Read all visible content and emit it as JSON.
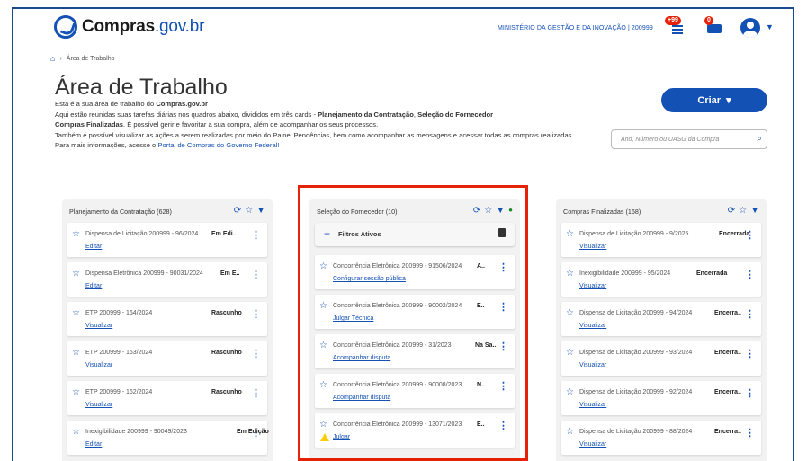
{
  "header": {
    "logo_text_bold": "Compras",
    "logo_text_domain": ".gov.br",
    "ministry": "MINISTÉRIO DA GESTÃO E DA INOVAÇÃO | 200999",
    "notif_badge": "+99",
    "msg_badge": "0"
  },
  "breadcrumb": {
    "current": "Área de Trabalho"
  },
  "page": {
    "title": "Área de Trabalho",
    "intro_l1": "Esta é a sua área de trabalho do ",
    "intro_l1_bold": "Compras.gov.br",
    "intro_l2a": "Aqui estão reunidas suas tarefas diárias nos quadros abaixo, divididos em três cards - ",
    "intro_l2b": "Planejamento da Contratação",
    "intro_l2c": ", ",
    "intro_l2d": "Seleção do Fornecedor",
    "intro_l2e": " e ",
    "intro_l2f": "Compras Finalizadas",
    "intro_l2g": ". É possível gerir e favoritar a sua compra, além de acompanhar os seus processos.",
    "intro_l3": "Também é possível visualizar as ações a serem realizadas por meio do Painel Pendências, bem como acompanhar as mensagens e acessar todas as compras realizadas.",
    "intro_l4a": "Para mais informações, acesse o ",
    "intro_l4b": "Portal de Compras do Governo Federal!",
    "criar_label": "Criar",
    "search_placeholder": "Ano, Número ou UASG da Compra"
  },
  "columns": [
    {
      "title": "Planejamento da Contratação (628)",
      "cards": [
        {
          "text": "Dispensa de Licitação 200999 - 96/2024",
          "status": "Em Edi..",
          "action": "Editar"
        },
        {
          "text": "Dispensa Eletrônica 200999 - 90031/2024",
          "status": "Em E..",
          "action": "Editar"
        },
        {
          "text": "ETP 200999 - 164/2024",
          "status": "Rascunho",
          "action": "Visualizar"
        },
        {
          "text": "ETP 200999 - 163/2024",
          "status": "Rascunho",
          "action": "Visualizar"
        },
        {
          "text": "ETP 200999 - 162/2024",
          "status": "Rascunho",
          "action": "Visualizar"
        },
        {
          "text": "Inexigibilidade 200999 - 90049/2023",
          "status": "Em Edição",
          "action": "Editar"
        }
      ]
    },
    {
      "title": "Seleção do Fornecedor (10)",
      "filter_label": "Filtros Ativos",
      "cards": [
        {
          "text": "Concorrência Eletrônica 200999 - 91506/2024",
          "status": "A..",
          "action": "Configurar sessão pública"
        },
        {
          "text": "Concorrência Eletrônica 200999 - 90002/2024",
          "status": "E..",
          "action": "Julgar Técnica"
        },
        {
          "text": "Concorrência Eletrônica 200999 - 31/2023",
          "status": "Na Sa..",
          "action": "Acompanhar disputa"
        },
        {
          "text": "Concorrência Eletrônica 200999 - 90008/2023",
          "status": "N..",
          "action": "Acompanhar disputa"
        },
        {
          "text": "Concorrência Eletrônica 200999 - 13071/2023",
          "status": "E..",
          "action": "Julgar"
        }
      ]
    },
    {
      "title": "Compras Finalizadas (168)",
      "cards": [
        {
          "text": "Dispensa de Licitação 200999 - 9/2025",
          "status": "Encerrada",
          "action": "Visualizar"
        },
        {
          "text": "Inexigibilidade 200999 - 95/2024",
          "status": "Encerrada",
          "action": "Visualizar"
        },
        {
          "text": "Dispensa de Licitação 200999 - 94/2024",
          "status": "Encerra..",
          "action": "Visualizar"
        },
        {
          "text": "Dispensa de Licitação 200999 - 93/2024",
          "status": "Encerra..",
          "action": "Visualizar"
        },
        {
          "text": "Dispensa de Licitação 200999 - 92/2024",
          "status": "Encerra..",
          "action": "Visualizar"
        },
        {
          "text": "Dispensa de Licitação 200999 - 88/2024",
          "status": "Encerra..",
          "action": "Visualizar"
        }
      ]
    }
  ],
  "colors": {
    "primary": "#1351b4",
    "highlight": "#e52207",
    "warning": "#ffcd07"
  }
}
